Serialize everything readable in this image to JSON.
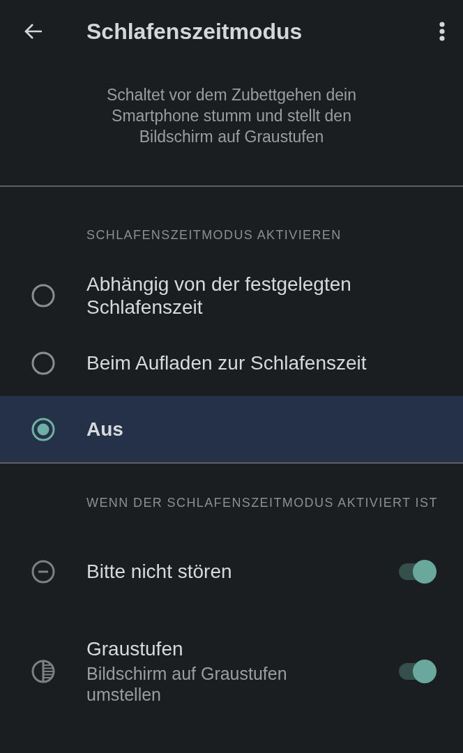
{
  "app_bar": {
    "title": "Schlafenszeitmodus"
  },
  "description": "Schaltet vor dem Zubettgehen dein Smartphone stumm und stellt den Bildschirm auf Graustufen",
  "sections": [
    {
      "kind": "radio",
      "header": "SCHLAFENSZEITMODUS AKTIVIEREN",
      "options": [
        {
          "label": "Abhängig von der festgelegten Schlafenszeit",
          "selected": false
        },
        {
          "label": "Beim Aufladen zur Schlafenszeit",
          "selected": false
        },
        {
          "label": "Aus",
          "selected": true
        }
      ]
    },
    {
      "kind": "toggles",
      "header": "WENN DER SCHLAFENSZEITMODUS AKTIVIERT IST",
      "items": [
        {
          "title": "Bitte nicht stören",
          "on": true
        },
        {
          "title": "Graustufen",
          "subtitle": "Bildschirm auf Graustufen umstellen",
          "on": true
        }
      ]
    }
  ]
}
